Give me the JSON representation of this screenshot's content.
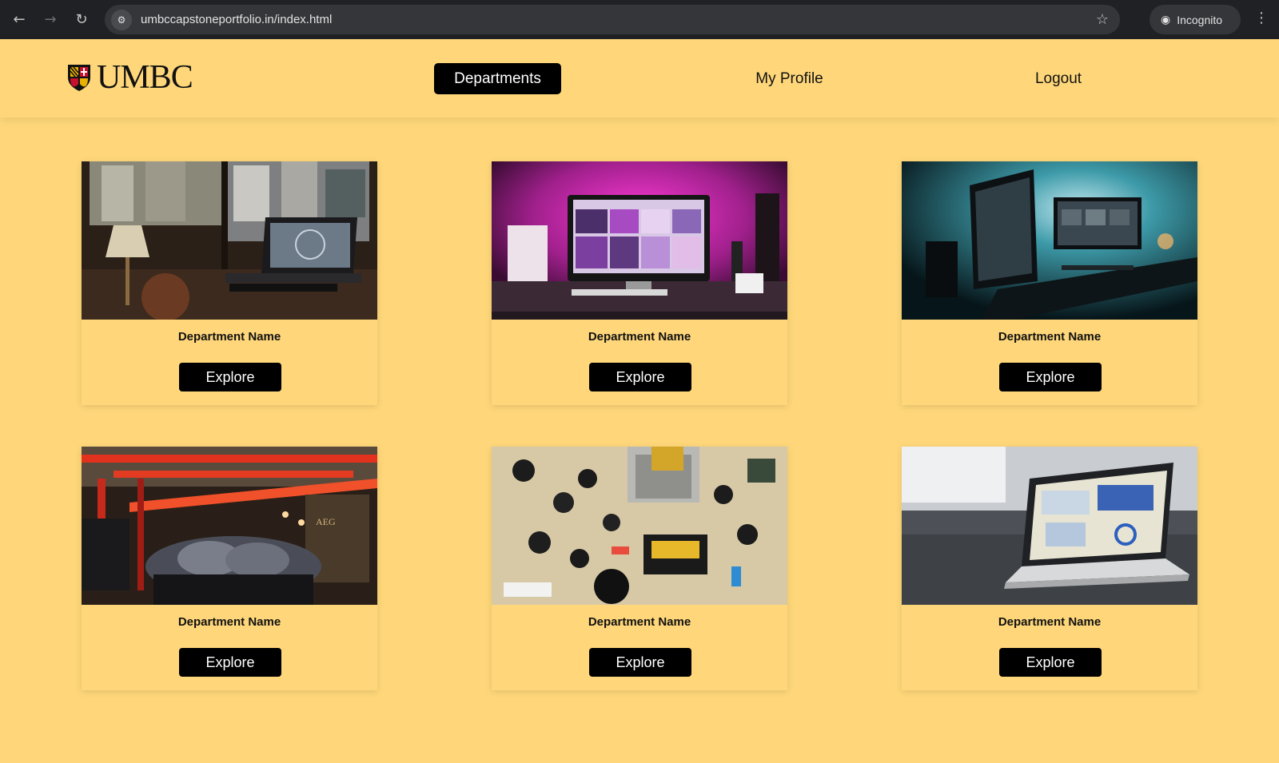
{
  "browser": {
    "url": "umbccapstoneportfolio.in/index.html",
    "incognito_label": "Incognito",
    "back_icon": "arrow-left-icon",
    "forward_icon": "arrow-right-icon",
    "reload_icon": "reload-icon",
    "site_info_icon": "tune-icon",
    "bookmark_icon": "star-icon",
    "menu_icon": "kebab-menu-icon"
  },
  "header": {
    "logo_text": "UMBC",
    "nav": [
      {
        "label": "Departments",
        "active": true
      },
      {
        "label": "My Profile",
        "active": false
      },
      {
        "label": "Logout",
        "active": false
      }
    ]
  },
  "cards": [
    {
      "name": "Department Name",
      "button": "Explore",
      "image": "desk-laptop-window-photo"
    },
    {
      "name": "Department Name",
      "button": "Explore",
      "image": "pink-imac-setup-photo"
    },
    {
      "name": "Department Name",
      "button": "Explore",
      "image": "teal-dual-monitor-photo"
    },
    {
      "name": "Department Name",
      "button": "Explore",
      "image": "industrial-machinery-photo"
    },
    {
      "name": "Department Name",
      "button": "Explore",
      "image": "circuit-board-photo"
    },
    {
      "name": "Department Name",
      "button": "Explore",
      "image": "laptop-dashboard-photo"
    }
  ],
  "colors": {
    "page_bg": "#ffd77a",
    "button_bg": "#000000",
    "button_text": "#ffffff"
  }
}
